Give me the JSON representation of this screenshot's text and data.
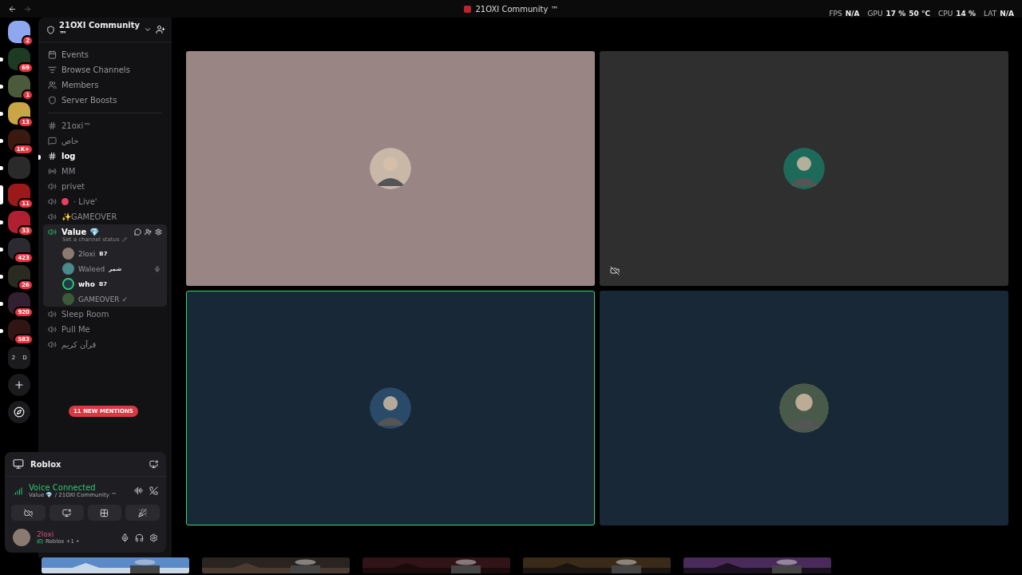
{
  "window": {
    "title": "21OXI Community ™"
  },
  "stats": [
    {
      "label": "FPS",
      "value": "N/A"
    },
    {
      "label": "GPU",
      "value": "17 %",
      "extra": "50 °C"
    },
    {
      "label": "CPU",
      "value": "14 %"
    },
    {
      "label": "LAT",
      "value": "N/A"
    }
  ],
  "servers": [
    {
      "badge": "2",
      "unread": false,
      "selected": false,
      "color": "#8ea8f0"
    },
    {
      "badge": "69",
      "unread": true,
      "selected": false,
      "color": "#1d3a22"
    },
    {
      "badge": "1",
      "unread": true,
      "selected": false,
      "color": "#4a5a3a"
    },
    {
      "badge": "13",
      "unread": true,
      "selected": false,
      "color": "#c9a545"
    },
    {
      "badge": "1K+",
      "unread": true,
      "selected": false,
      "color": "#3a1a10"
    },
    {
      "unread": true,
      "selected": false,
      "color": "#2a2a2a"
    },
    {
      "badge": "11",
      "unread": false,
      "selected": true,
      "color": "#9a1a1a"
    },
    {
      "badge": "33",
      "unread": true,
      "selected": false,
      "color": "#b02030"
    },
    {
      "badge": "423",
      "unread": true,
      "selected": false,
      "color": "#2a2a30"
    },
    {
      "badge": "26",
      "unread": true,
      "selected": false,
      "color": "#2a2a20"
    },
    {
      "badge": "920",
      "unread": true,
      "selected": false,
      "color": "#302030"
    },
    {
      "badge": "583",
      "unread": true,
      "selected": false,
      "color": "#301515"
    }
  ],
  "folder": {
    "labels": [
      "2",
      "D"
    ]
  },
  "server": {
    "name": "21OXI Community ™"
  },
  "nav": [
    {
      "kind": "events",
      "label": "Events"
    },
    {
      "kind": "browse",
      "label": "Browse Channels"
    },
    {
      "kind": "members",
      "label": "Members"
    },
    {
      "kind": "boosts",
      "label": "Server Boosts"
    }
  ],
  "channels": [
    {
      "kind": "text",
      "name": "21oxi™",
      "unread": false
    },
    {
      "kind": "forum",
      "name": "خاص",
      "unread": false
    },
    {
      "kind": "text",
      "name": "log",
      "unread": true
    },
    {
      "kind": "stage",
      "name": "MM",
      "unread": false
    },
    {
      "kind": "voice",
      "name": "privet",
      "unread": false
    },
    {
      "kind": "voice",
      "name": "· Live'",
      "unread": false,
      "color": "#e5405e"
    },
    {
      "kind": "voice",
      "name": "✨GAMEOVER",
      "unread": false
    },
    {
      "kind": "active-voice",
      "name": "Value 💎",
      "status": "Set a channel status",
      "users": [
        {
          "name": "2loxi",
          "tag": "B7",
          "speaking": false,
          "muted": false
        },
        {
          "name": "Waleed",
          "tag": "شمر",
          "speaking": false,
          "muted": true
        },
        {
          "name": "who",
          "tag": "B7",
          "speaking": true,
          "muted": false
        },
        {
          "name": "GAMEOVER ✓",
          "speaking": false,
          "muted": false
        }
      ]
    },
    {
      "kind": "voice",
      "name": "Sleep Room",
      "unread": false
    },
    {
      "kind": "voice",
      "name": "Pull Me",
      "unread": false
    },
    {
      "kind": "voice",
      "name": "قرآن كريم",
      "unread": false
    }
  ],
  "mentions": "11 NEW MENTIONS",
  "activity": {
    "game": "Roblox"
  },
  "voice": {
    "status": "Voice Connected",
    "location": "Value 💎 / 21OXI Community ™"
  },
  "user": {
    "name": "2loxi",
    "activity": "Roblox +1 •"
  },
  "tiles": [
    {
      "speaking": false,
      "video_off": false
    },
    {
      "speaking": false,
      "video_off": true
    },
    {
      "speaking": true,
      "video_off": false
    },
    {
      "speaking": false,
      "video_off": false
    }
  ]
}
